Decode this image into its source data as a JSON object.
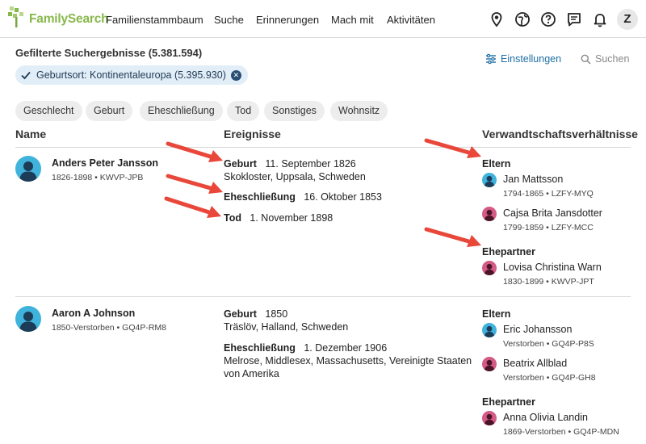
{
  "header": {
    "brand": "FamilySearch",
    "nav": [
      "Familienstammbaum",
      "Suche",
      "Erinnerungen",
      "Mach mit",
      "Aktivitäten"
    ],
    "avatar_letter": "Z",
    "icons": [
      "location-pin-icon",
      "globe-icon",
      "help-icon",
      "message-icon",
      "bell-icon"
    ]
  },
  "results": {
    "title": "Gefilterte Suchergebnisse (5.381.594)",
    "filter_chip": "Geburtsort: Kontinentaleuropa (5.395.930)",
    "settings_label": "Einstellungen",
    "search_label": "Suchen"
  },
  "filters": [
    "Geschlecht",
    "Geburt",
    "Eheschließung",
    "Tod",
    "Sonstiges",
    "Wohnsitz"
  ],
  "columns": {
    "name": "Name",
    "events": "Ereignisse",
    "relations": "Verwandtschaftsverhältnisse"
  },
  "records": [
    {
      "name": "Anders Peter Jansson",
      "meta": "1826-1898 •   KWVP-JPB",
      "events": [
        {
          "label": "Geburt",
          "value": "11. September 1826",
          "place": "Skokloster, Uppsala, Schweden"
        },
        {
          "label": "Eheschließung",
          "value": "16. Oktober 1853"
        },
        {
          "label": "Tod",
          "value": "1. November 1898"
        }
      ],
      "parents_label": "Eltern",
      "parents": [
        {
          "name": "Jan Mattsson",
          "meta": "1794-1865 •   LZFY-MYQ",
          "gender": "male"
        },
        {
          "name": "Cajsa Brita Jansdotter",
          "meta": "1799-1859 •   LZFY-MCC",
          "gender": "female"
        }
      ],
      "spouse_label": "Ehepartner",
      "spouses": [
        {
          "name": "Lovisa Christina Warn",
          "meta": "1830-1899 •   KWVP-JPT",
          "gender": "female"
        }
      ]
    },
    {
      "name": "Aaron A Johnson",
      "meta": "1850-Verstorben •   GQ4P-RM8",
      "events": [
        {
          "label": "Geburt",
          "value": "1850",
          "place": "Träslöv, Halland, Schweden"
        },
        {
          "label": "Eheschließung",
          "value": "1. Dezember 1906",
          "place": "Melrose, Middlesex, Massachusetts, Vereinigte Staaten",
          "place2": "von Amerika"
        }
      ],
      "parents_label": "Eltern",
      "parents": [
        {
          "name": "Eric Johansson",
          "meta": "Verstorben •   GQ4P-P8S",
          "gender": "male"
        },
        {
          "name": "Beatrix Allblad",
          "meta": "Verstorben •   GQ4P-GH8",
          "gender": "female"
        }
      ],
      "spouse_label": "Ehepartner",
      "spouses": [
        {
          "name": "Anna Olivia Landin",
          "meta": "1869-Verstorben •   GQ4P-MDN",
          "gender": "female"
        }
      ]
    }
  ],
  "colors": {
    "accent": "#1e6fa5",
    "arrow": "#e8473a",
    "male_bg": "#3fb3dc",
    "female_bg": "#d45a86",
    "brand_green": "#87b84a"
  }
}
